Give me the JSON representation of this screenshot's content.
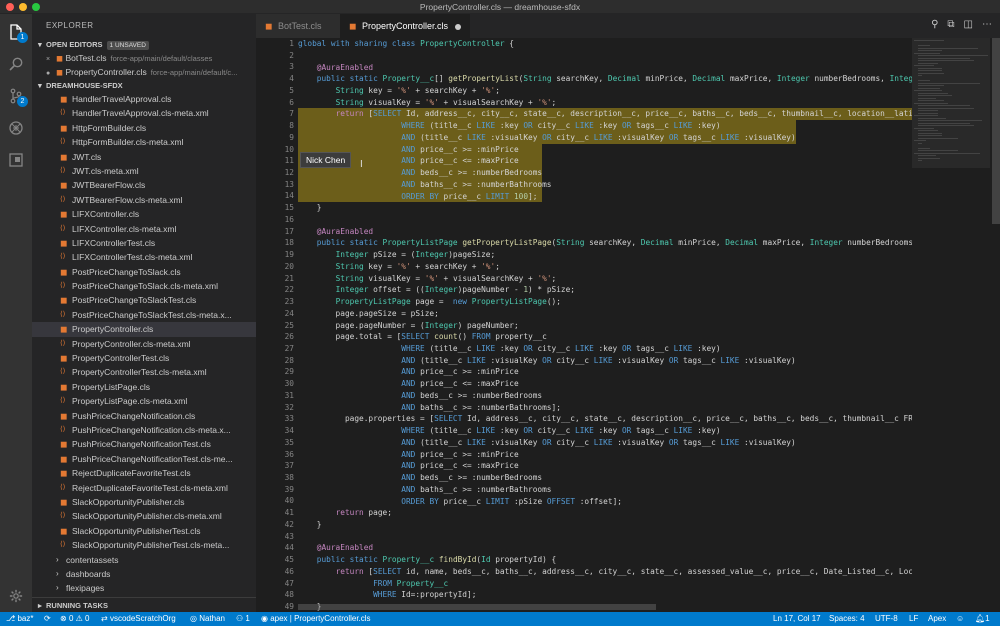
{
  "window": {
    "title": "PropertyController.cls — dreamhouse-sfdx"
  },
  "colors": {
    "accent": "#007acc",
    "file_icon": "#e37933",
    "selection": "#7a6a1a"
  },
  "activity_bar": [
    {
      "name": "explorer-icon",
      "badge": "1"
    },
    {
      "name": "search-icon",
      "badge": ""
    },
    {
      "name": "source-control-icon",
      "badge": "2"
    },
    {
      "name": "debug-icon",
      "badge": ""
    },
    {
      "name": "extensions-icon",
      "badge": ""
    }
  ],
  "sidebar": {
    "title": "EXPLORER",
    "open_editors": {
      "label": "OPEN EDITORS",
      "badge": "1 UNSAVED",
      "items": [
        {
          "name": "BotTest.cls",
          "path": "force-app/main/default/classes",
          "marker": "×"
        },
        {
          "name": "PropertyController.cls",
          "path": "force-app/main/default/c...",
          "marker": "●"
        }
      ]
    },
    "project": {
      "label": "DREAMHOUSE-SFDX",
      "files": [
        "HandlerTravelApproval.cls",
        "HandlerTravelApproval.cls-meta.xml",
        "HttpFormBuilder.cls",
        "HttpFormBuilder.cls-meta.xml",
        "JWT.cls",
        "JWT.cls-meta.xml",
        "JWTBearerFlow.cls",
        "JWTBearerFlow.cls-meta.xml",
        "LIFXController.cls",
        "LIFXController.cls-meta.xml",
        "LIFXControllerTest.cls",
        "LIFXControllerTest.cls-meta.xml",
        "PostPriceChangeToSlack.cls",
        "PostPriceChangeToSlack.cls-meta.xml",
        "PostPriceChangeToSlackTest.cls",
        "PostPriceChangeToSlackTest.cls-meta.x...",
        "PropertyController.cls",
        "PropertyController.cls-meta.xml",
        "PropertyControllerTest.cls",
        "PropertyControllerTest.cls-meta.xml",
        "PropertyListPage.cls",
        "PropertyListPage.cls-meta.xml",
        "PushPriceChangeNotification.cls",
        "PushPriceChangeNotification.cls-meta.x...",
        "PushPriceChangeNotificationTest.cls",
        "PushPriceChangeNotificationTest.cls-me...",
        "RejectDuplicateFavoriteTest.cls",
        "RejectDuplicateFavoriteTest.cls-meta.xml",
        "SlackOpportunityPublisher.cls",
        "SlackOpportunityPublisher.cls-meta.xml",
        "SlackOpportunityPublisherTest.cls",
        "SlackOpportunityPublisherTest.cls-meta..."
      ],
      "folders": [
        "contentassets",
        "dashboards",
        "flexipages"
      ]
    },
    "running_tasks": "RUNNING TASKS"
  },
  "tabs": [
    {
      "label": "BotTest.cls",
      "active": false
    },
    {
      "label": "PropertyController.cls",
      "active": true,
      "unsaved": true
    }
  ],
  "editor": {
    "tooltip": "Nick Chen",
    "line_numbers": [
      "1",
      "2",
      "3",
      "4",
      "5",
      "6",
      "7",
      "8",
      "9",
      "10",
      "11",
      "12",
      "13",
      "14",
      "15",
      "16",
      "17",
      "18",
      "19",
      "20",
      "21",
      "22",
      "23",
      "24",
      "25",
      "26",
      "27",
      "28",
      "29",
      "30",
      "31",
      "32",
      "33",
      "34",
      "35",
      "36",
      "37",
      "38",
      "39",
      "40",
      "41",
      "42",
      "43",
      "44",
      "45",
      "46",
      "47",
      "48",
      "49"
    ]
  },
  "statusbar": {
    "branch": "baz*",
    "errors": "0",
    "warnings": "0",
    "org": "vscodeScratchOrg",
    "user": "Nathan",
    "count": "1",
    "lang_file": "apex | PropertyController.cls",
    "position": "Ln 17, Col 17",
    "spaces": "Spaces: 4",
    "encoding": "UTF-8",
    "eol": "LF",
    "language": "Apex",
    "notifications": "1"
  }
}
